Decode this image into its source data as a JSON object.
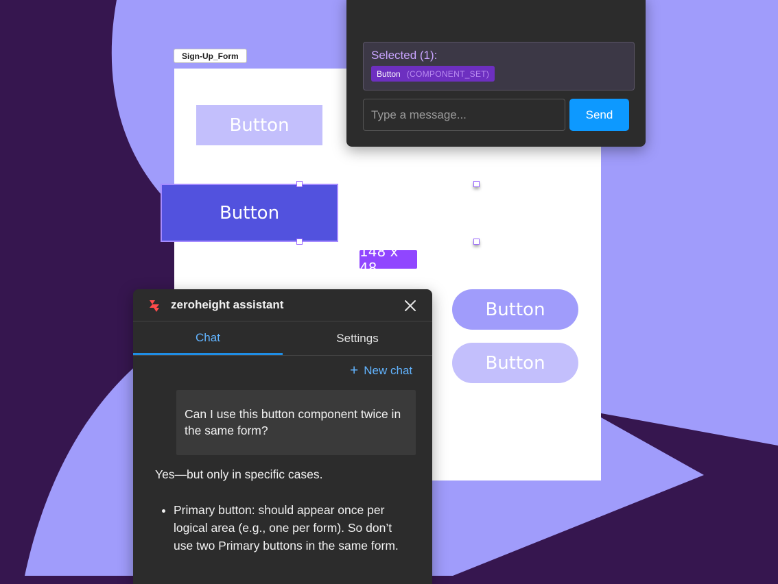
{
  "canvas": {
    "frame_label": "Sign-Up_Form",
    "buttons": [
      "Button",
      "Button",
      "Button",
      "Button"
    ],
    "dimension_badge": "148 x 48"
  },
  "top_panel": {
    "selected_title": "Selected (1):",
    "selected_name": "Button",
    "selected_type": "(COMPONENT_SET)",
    "message_placeholder": "Type a message...",
    "send_label": "Send"
  },
  "assistant": {
    "logo_icon": "zeroheight-logo-icon",
    "title": "zeroheight assistant",
    "close_icon": "close-icon",
    "tabs": [
      {
        "label": "Chat",
        "active": true
      },
      {
        "label": "Settings",
        "active": false
      }
    ],
    "new_chat_icon": "plus-icon",
    "new_chat_label": "New chat",
    "user_message": "Can I use this button component twice in the same form?",
    "answer_intro": "Yes—but only in specific cases.",
    "answer_bullets": [
      "Primary button: should appear once per logical area (e.g., one per form). So don’t use two Primary buttons in the same form."
    ]
  },
  "colors": {
    "background": "#36164f",
    "shape_lilac": "#a09cfb",
    "primary_button": "#5252de",
    "selection": "#9046ff",
    "send_button": "#0d99ff",
    "tab_active": "#62b4ff"
  }
}
